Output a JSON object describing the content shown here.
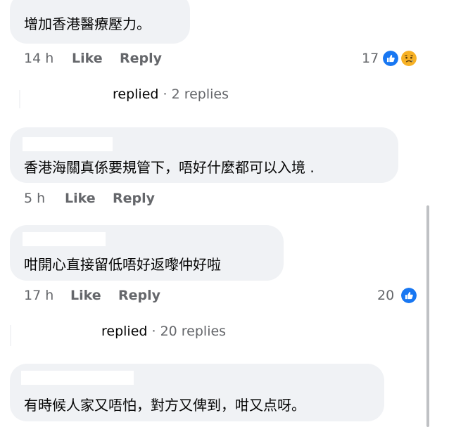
{
  "comments": [
    {
      "text": "增加香港醫療壓力。",
      "time": "14 h",
      "like_label": "Like",
      "reply_label": "Reply",
      "reaction_count": "17",
      "reactions": [
        "like-icon",
        "sad-icon"
      ],
      "replies_summary": {
        "who": "replied",
        "count": " · 2 replies"
      }
    },
    {
      "text": "香港海關真係要規管下，唔好什麼都可以入境 .",
      "time": "5 h",
      "like_label": "Like",
      "reply_label": "Reply"
    },
    {
      "text": "咁開心直接留低唔好返嚟仲好啦",
      "time": "17 h",
      "like_label": "Like",
      "reply_label": "Reply",
      "reaction_count": "20",
      "reactions": [
        "like-icon"
      ],
      "replies_summary": {
        "who": "replied",
        "count": " · 20 replies"
      }
    },
    {
      "text": "有時候人家又唔怕，對方又俾到，咁又点呀。"
    }
  ],
  "colors": {
    "bubble": "#f0f2f5",
    "meta_text": "#65676b",
    "like_blue": "#1877f2",
    "sad_yellow": "#f7b125"
  }
}
